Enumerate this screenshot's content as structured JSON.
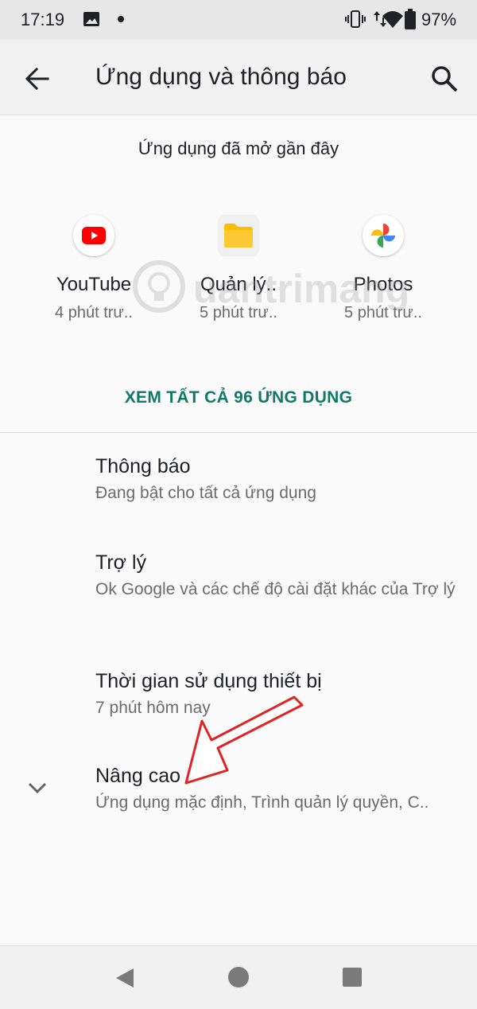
{
  "status_bar": {
    "time": "17:19",
    "battery": "97%"
  },
  "app_bar": {
    "title": "Ứng dụng và thông báo"
  },
  "recent": {
    "header": "Ứng dụng đã mở gần đây",
    "apps": [
      {
        "name": "YouTube",
        "time": "4 phút trư.."
      },
      {
        "name": "Quản lý..",
        "time": "5 phút trư.."
      },
      {
        "name": "Photos",
        "time": "5 phút trư.."
      }
    ],
    "see_all": "XEM TẤT CẢ 96 ỨNG DỤNG"
  },
  "settings": [
    {
      "title": "Thông báo",
      "subtitle": "Đang bật cho tất cả ứng dụng"
    },
    {
      "title": "Trợ lý",
      "subtitle": "Ok Google và các chế độ cài đặt khác của Trợ lý"
    },
    {
      "title": "Thời gian sử dụng thiết bị",
      "subtitle": "7 phút hôm nay"
    },
    {
      "title": "Nâng cao",
      "subtitle": "Ứng dụng mặc định, Trình quản lý quyền, C.."
    }
  ],
  "watermark": "uantrimang",
  "colors": {
    "accent": "#0e7a66",
    "annotation_arrow": "#e02424",
    "youtube": "#ff0000",
    "folder": "#fbbc04"
  },
  "icons": [
    "image-icon",
    "vibrate-icon",
    "data-arrows-icon",
    "wifi-icon",
    "battery-icon",
    "back-arrow-icon",
    "search-icon",
    "youtube-icon",
    "files-folder-icon",
    "photos-pinwheel-icon",
    "chevron-down-icon",
    "nav-back-icon",
    "nav-home-icon",
    "nav-recents-icon"
  ]
}
